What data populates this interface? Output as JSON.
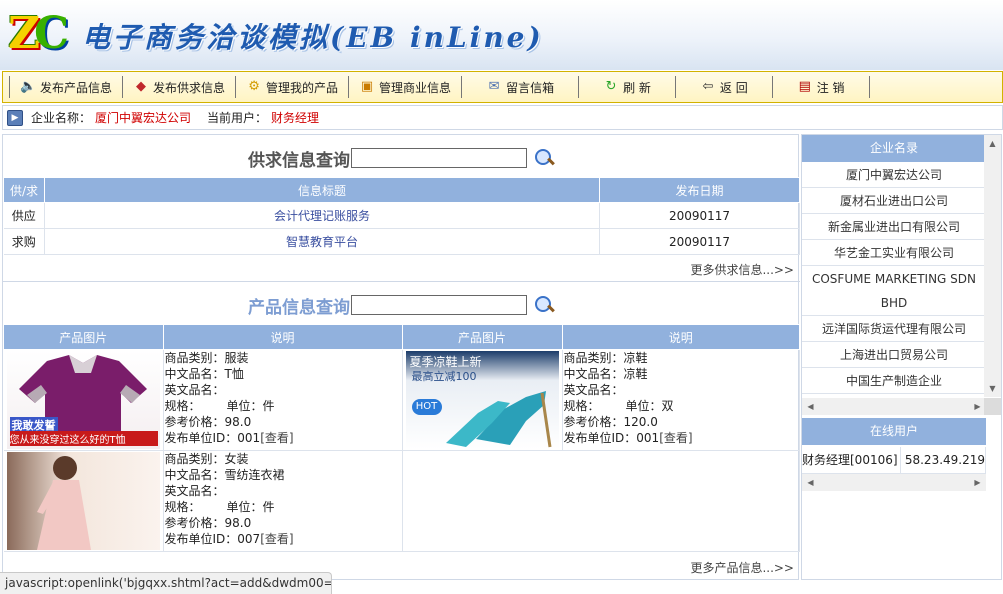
{
  "header": {
    "logo_text_z": "Z",
    "logo_text_c": "C",
    "title": "电子商务洽谈模拟(EB inLine)"
  },
  "toolbar": [
    {
      "label": "发布产品信息",
      "icon": "speaker-icon"
    },
    {
      "label": "发布供求信息",
      "icon": "diamond-icon"
    },
    {
      "label": "管理我的产品",
      "icon": "gear-icon"
    },
    {
      "label": "管理商业信息",
      "icon": "box-icon"
    },
    {
      "label": "留言信箱",
      "icon": "mailbox-icon"
    },
    {
      "label": "刷 新",
      "icon": "refresh-icon"
    },
    {
      "label": "返 回",
      "icon": "back-arrow-icon"
    },
    {
      "label": "注 销",
      "icon": "logout-icon"
    }
  ],
  "infobar": {
    "company_label": "企业名称：",
    "company": "厦门中翼宏达公司",
    "user_label": "当前用户：",
    "user": "财务经理"
  },
  "supply": {
    "title": "供求信息查询",
    "columns": [
      "供/求",
      "信息标题",
      "发布日期"
    ],
    "rows": [
      {
        "type": "供应",
        "title": "会计代理记账服务",
        "date": "20090117"
      },
      {
        "type": "求购",
        "title": "智慧教育平台",
        "date": "20090117"
      }
    ],
    "more": "更多供求信息...>>"
  },
  "products": {
    "title": "产品信息查询",
    "columns": [
      "产品图片",
      "说明",
      "产品图片",
      "说明"
    ],
    "labels": {
      "category": "商品类别：",
      "cn_name": "中文品名：",
      "en_name": "英文品名：",
      "spec": "规格：",
      "unit": "单位：",
      "price": "参考价格：",
      "publisher": "发布单位ID：",
      "view": "[查看]"
    },
    "items": [
      {
        "category": "服装",
        "cn_name": "T恤",
        "en_name": "",
        "spec": "",
        "unit": "件",
        "price": "98.0",
        "publisher_id": "001",
        "img_text1": "我敢发誓",
        "img_text2": "您从来没穿过这么好的T恤"
      },
      {
        "category": "凉鞋",
        "cn_name": "凉鞋",
        "en_name": "",
        "spec": "",
        "unit": "双",
        "price": "120.0",
        "publisher_id": "001",
        "img_text1": "夏季凉鞋上新",
        "img_text2": "最高立减100",
        "img_text3": "HOT"
      },
      {
        "category": "女装",
        "cn_name": "雪纺连衣裙",
        "en_name": "",
        "spec": "",
        "unit": "件",
        "price": "98.0",
        "publisher_id": "007"
      }
    ],
    "more": "更多产品信息...>>"
  },
  "sidebar": {
    "companies_title": "企业名录",
    "companies": [
      "厦门中翼宏达公司",
      "厦材石业进出口公司",
      "新金属业进出口有限公司",
      "华艺金工实业有限公司",
      "COSFUME MARKETING SDN BHD",
      "远洋国际货运代理有限公司",
      "上海进出口贸易公司",
      "中国生产制造企业"
    ],
    "online_title": "在线用户",
    "online_users": [
      {
        "name": "财务经理[00106]",
        "ip": "58.23.49.219"
      }
    ]
  },
  "statusbar": "javascript:openlink('bjgqxx.shtml?act=add&dwdm00=..."
}
